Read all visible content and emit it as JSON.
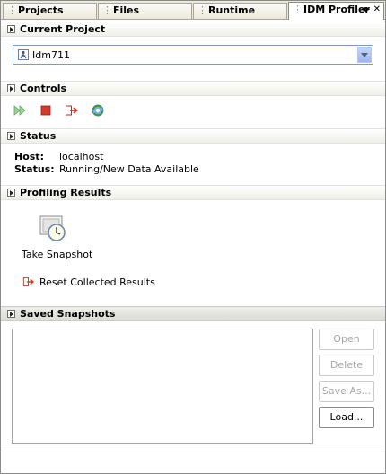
{
  "tabs": [
    {
      "label": "Projects"
    },
    {
      "label": "Files"
    },
    {
      "label": "Runtime"
    },
    {
      "label": "IDM Profiler"
    }
  ],
  "sections": {
    "current_project": "Current Project",
    "controls": "Controls",
    "status": "Status",
    "profiling_results": "Profiling Results",
    "saved_snapshots": "Saved Snapshots"
  },
  "project": {
    "selected": "Idm711"
  },
  "status": {
    "host_label": "Host:",
    "host_value": "localhost",
    "status_label": "Status:",
    "status_value": "Running/New Data Available"
  },
  "profiling": {
    "take_snapshot": "Take Snapshot",
    "reset_results": "Reset Collected Results"
  },
  "snapshots": {
    "open": "Open",
    "delete": "Delete",
    "save_as": "Save As...",
    "load": "Load..."
  },
  "icons": [
    "project-icon",
    "resume-icon",
    "stop-icon",
    "detach-icon",
    "gc-icon",
    "snapshot-icon",
    "reset-icon"
  ]
}
